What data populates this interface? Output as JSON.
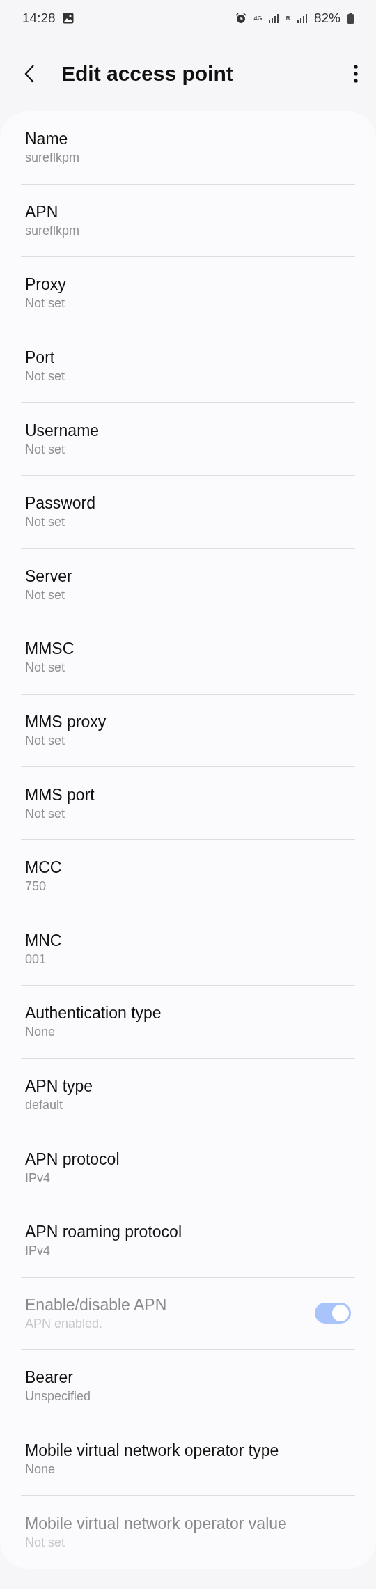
{
  "status_bar": {
    "time": "14:28",
    "network": "4G",
    "roaming": "R",
    "battery": "82%"
  },
  "header": {
    "title": "Edit access point"
  },
  "settings": [
    {
      "kind": "text",
      "title": "Name",
      "value": "sureflkpm",
      "disabled": false
    },
    {
      "kind": "text",
      "title": "APN",
      "value": "sureflkpm",
      "disabled": false
    },
    {
      "kind": "text",
      "title": "Proxy",
      "value": "Not set",
      "disabled": false
    },
    {
      "kind": "text",
      "title": "Port",
      "value": "Not set",
      "disabled": false
    },
    {
      "kind": "text",
      "title": "Username",
      "value": "Not set",
      "disabled": false
    },
    {
      "kind": "text",
      "title": "Password",
      "value": "Not set",
      "disabled": false
    },
    {
      "kind": "text",
      "title": "Server",
      "value": "Not set",
      "disabled": false
    },
    {
      "kind": "text",
      "title": "MMSC",
      "value": "Not set",
      "disabled": false
    },
    {
      "kind": "text",
      "title": "MMS proxy",
      "value": "Not set",
      "disabled": false
    },
    {
      "kind": "text",
      "title": "MMS port",
      "value": "Not set",
      "disabled": false
    },
    {
      "kind": "text",
      "title": "MCC",
      "value": "750",
      "disabled": false
    },
    {
      "kind": "text",
      "title": "MNC",
      "value": "001",
      "disabled": false
    },
    {
      "kind": "text",
      "title": "Authentication type",
      "value": "None",
      "disabled": false
    },
    {
      "kind": "text",
      "title": "APN type",
      "value": "default",
      "disabled": false
    },
    {
      "kind": "text",
      "title": "APN protocol",
      "value": "IPv4",
      "disabled": false
    },
    {
      "kind": "text",
      "title": "APN roaming protocol",
      "value": "IPv4",
      "disabled": false
    },
    {
      "kind": "toggle",
      "title": "Enable/disable APN",
      "value": "APN enabled.",
      "disabled": true,
      "on": true
    },
    {
      "kind": "text",
      "title": "Bearer",
      "value": "Unspecified",
      "disabled": false
    },
    {
      "kind": "text",
      "title": "Mobile virtual network operator type",
      "value": "None",
      "disabled": false
    },
    {
      "kind": "text",
      "title": "Mobile virtual network operator value",
      "value": "Not set",
      "disabled": true
    }
  ]
}
